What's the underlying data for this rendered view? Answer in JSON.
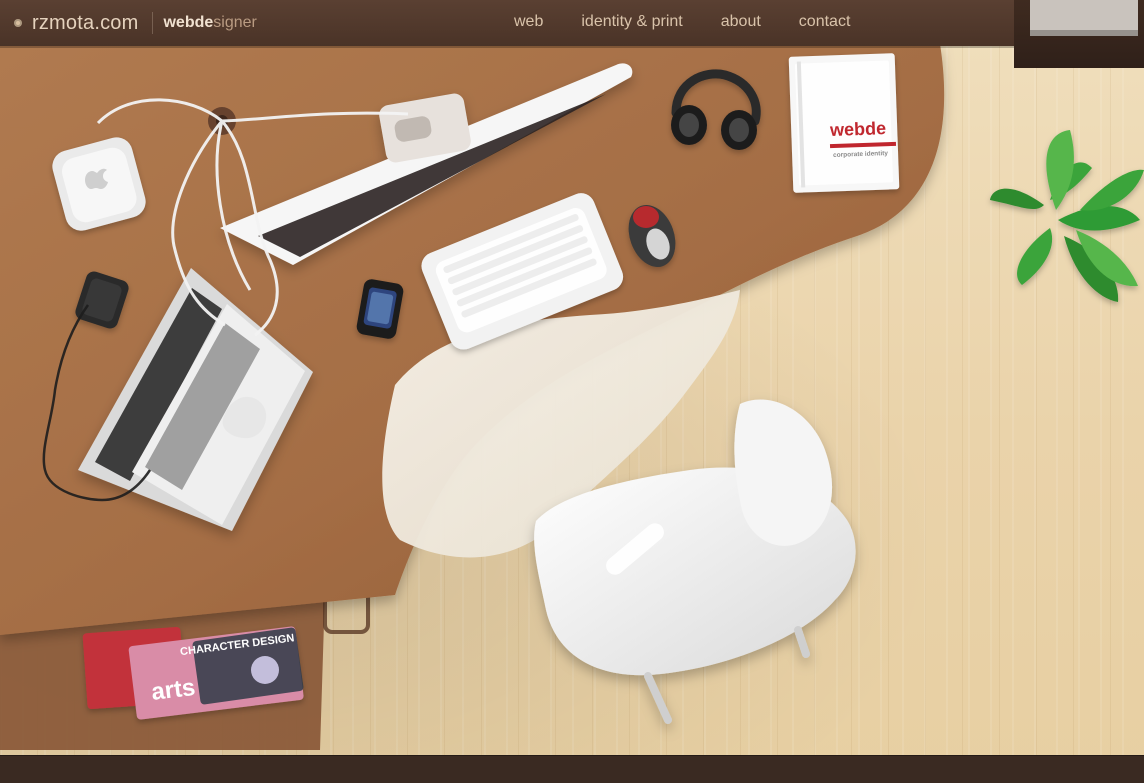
{
  "header": {
    "logo_text": "rzmota.com",
    "tagline_bold": "webde",
    "tagline_thin": "signer"
  },
  "nav": {
    "items": [
      {
        "label": "web"
      },
      {
        "label": "identity & print"
      },
      {
        "label": "about"
      },
      {
        "label": "contact"
      }
    ]
  },
  "scene": {
    "corporate_identity_brand": "webde",
    "corporate_identity_caption": "corporate identity",
    "magazine_1_title": "arts",
    "magazine_2_title": "CHARACTER DESIGN"
  },
  "colors": {
    "topbar": "#4a3327",
    "desk": "#a26d45",
    "floor": "#ead3aa",
    "accent_red": "#c0282f"
  }
}
